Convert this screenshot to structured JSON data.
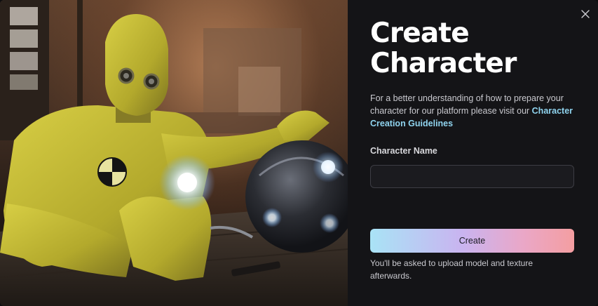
{
  "dialog": {
    "title": "Create Character",
    "description_text": "For a better understanding of how to prepare your character for our platform please visit our ",
    "guidelines_link": "Character Creation Guidelines",
    "name_label": "Character Name",
    "name_value": "",
    "name_placeholder": "",
    "create_label": "Create",
    "note": "You'll be asked to upload model and texture afterwards.",
    "close_icon": "close-icon"
  },
  "artwork": {
    "description_icon": "crash-test-dummy-illustration"
  },
  "colors": {
    "panel_bg": "#141417",
    "link": "#8fd3ee",
    "button_gradient_start": "#a9e3f6",
    "button_gradient_end": "#f49ea1",
    "dummy_yellow": "#c9c23a"
  }
}
